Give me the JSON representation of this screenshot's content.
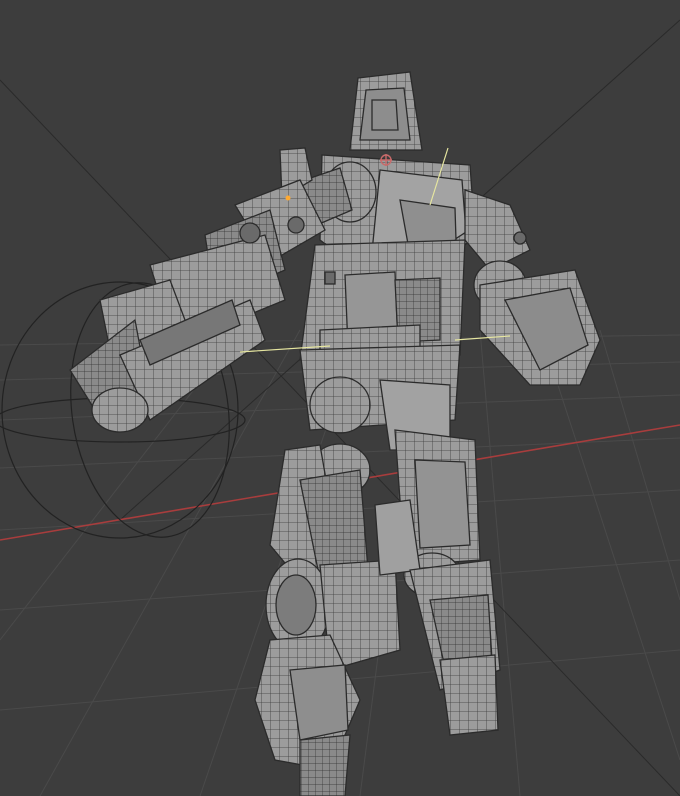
{
  "viewport": {
    "background_color": "#3d3d3d",
    "grid_line_color": "#4a4a4a",
    "x_axis_color": "#a83d3d",
    "model_fill": "#9a9a9a",
    "model_wire": "#2b2b2b",
    "selection_line_color": "#e6e6a0",
    "origin_marker_color": "#c86a6a",
    "gizmo_circle_color": "#222222"
  },
  "scene": {
    "object_type": "robot-mech-model",
    "shading": "solid-wireframe",
    "light_object": "rotate-gizmo-circles"
  }
}
